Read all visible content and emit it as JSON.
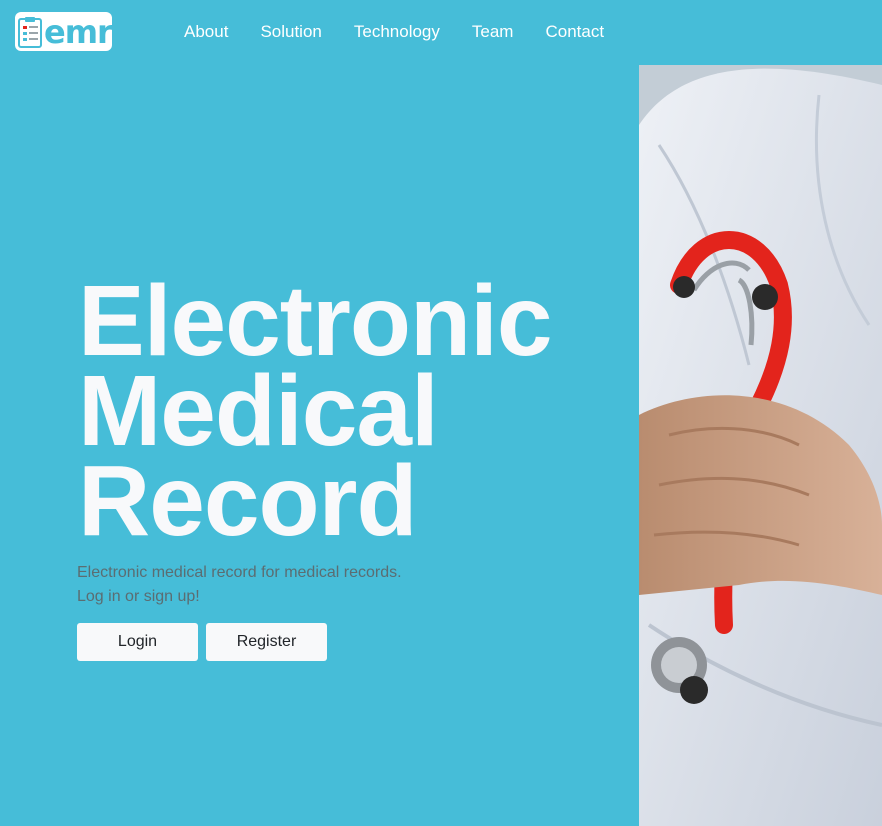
{
  "brand": {
    "logo_text": "emr",
    "logo_icon": "clipboard-icon"
  },
  "nav": {
    "items": [
      {
        "label": "About"
      },
      {
        "label": "Solution"
      },
      {
        "label": "Technology"
      },
      {
        "label": "Team"
      },
      {
        "label": "Contact"
      }
    ]
  },
  "hero": {
    "title_lines": [
      "Electronic",
      "Medical",
      "Record"
    ],
    "subtitle_lines": [
      "Electronic medical record for medical records.",
      "Log in or sign up!"
    ],
    "buttons": {
      "login": "Login",
      "register": "Register"
    }
  },
  "image": {
    "subject": "doctor-with-stethoscope-photo"
  },
  "colors": {
    "background": "#46bdd8",
    "title": "#f8f9fb",
    "subtitle": "#5b6d72",
    "button_bg": "#f8f9fa",
    "stethoscope": "#e3241c"
  }
}
